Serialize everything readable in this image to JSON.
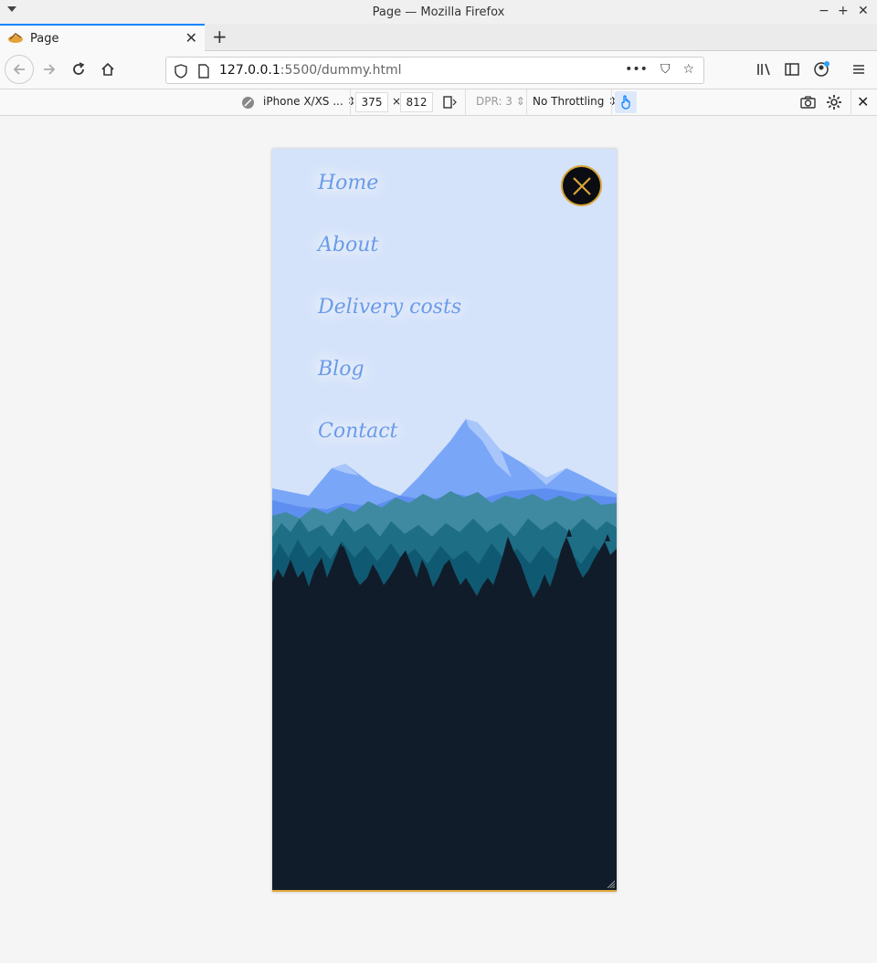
{
  "window": {
    "title": "Page — Mozilla Firefox"
  },
  "tabs": [
    {
      "label": "Page"
    }
  ],
  "navbar": {
    "url_host": "127.0.0.1",
    "url_path": ":5500/dummy.html"
  },
  "rdm": {
    "device": "iPhone X/XS ...",
    "width": "375",
    "times": "×",
    "height": "812",
    "dpr": "DPR: 3",
    "throttling": "No Throttling"
  },
  "page": {
    "menu": [
      "Home",
      "About",
      "Delivery costs",
      "Blog",
      "Contact"
    ],
    "colors": {
      "sky": "#d4e3fa",
      "link": "#6a9be8",
      "mountain": "#7aa6f8",
      "forest_dark": "#111c2b",
      "close_bg": "#0b0d12",
      "accent": "#d9a53a"
    },
    "icons": {
      "close": "close-x-icon"
    }
  }
}
